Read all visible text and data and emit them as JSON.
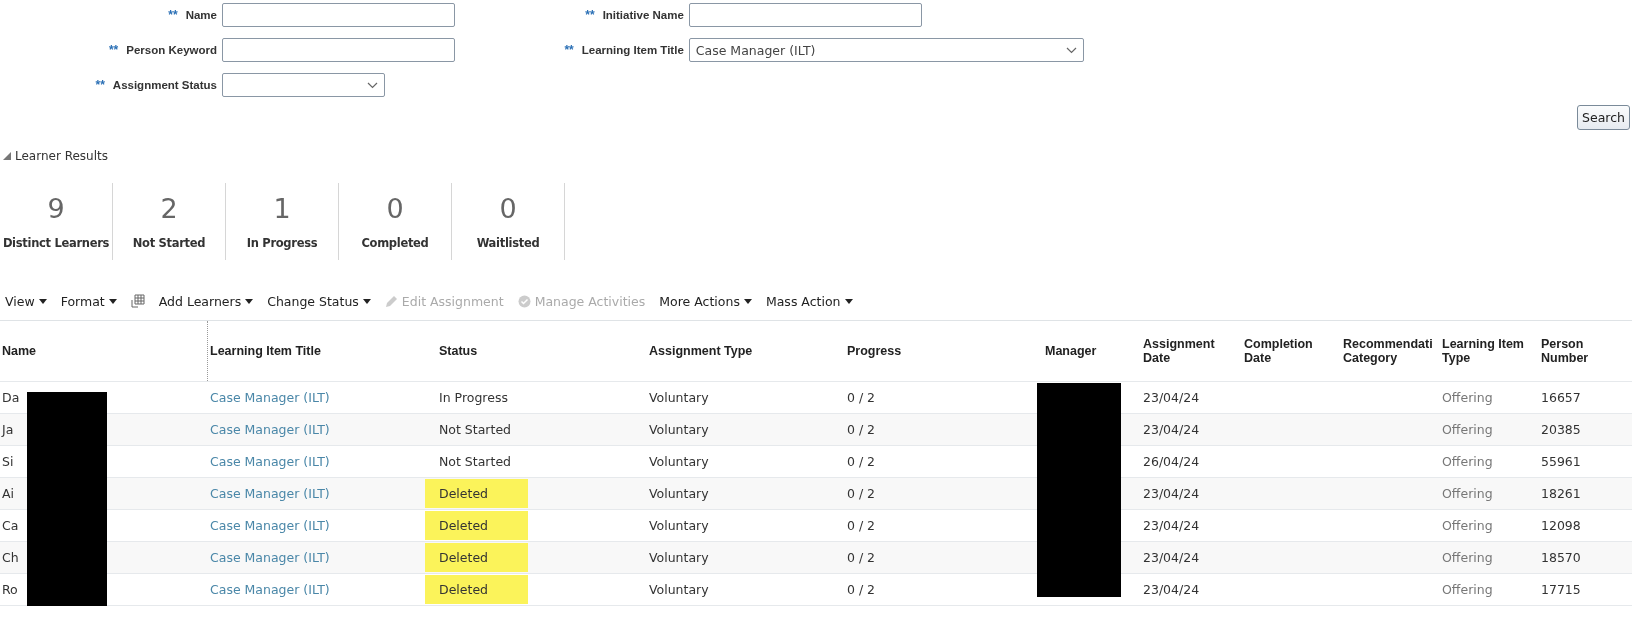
{
  "search_form": {
    "left_fields": [
      {
        "marker": "**",
        "label": "Name",
        "kind": "text"
      },
      {
        "marker": "**",
        "label": "Person Keyword",
        "kind": "text"
      },
      {
        "marker": "**",
        "label": "Assignment Status",
        "kind": "select"
      }
    ],
    "right_fields": [
      {
        "marker": "**",
        "label": "Initiative Name",
        "kind": "text"
      },
      {
        "marker": "**",
        "label": "Learning Item Title",
        "kind": "select",
        "value": "Case Manager (ILT)"
      }
    ],
    "search_button": "Search"
  },
  "section": {
    "title": "Learner Results",
    "expanded": true
  },
  "tiles": [
    {
      "value": "9",
      "label": "Distinct Learners"
    },
    {
      "value": "2",
      "label": "Not Started"
    },
    {
      "value": "1",
      "label": "In Progress"
    },
    {
      "value": "0",
      "label": "Completed"
    },
    {
      "value": "0",
      "label": "Waitlisted"
    }
  ],
  "toolbar": [
    {
      "kind": "menu",
      "label": "View",
      "disabled": false
    },
    {
      "kind": "menu",
      "label": "Format",
      "disabled": false
    },
    {
      "kind": "grid"
    },
    {
      "kind": "menu",
      "label": "Add Learners",
      "disabled": false
    },
    {
      "kind": "menu",
      "label": "Change Status",
      "disabled": false
    },
    {
      "kind": "edit",
      "label": "Edit Assignment",
      "disabled": true
    },
    {
      "kind": "check",
      "label": "Manage Activities",
      "disabled": true
    },
    {
      "kind": "menu",
      "label": "More Actions",
      "disabled": false
    },
    {
      "kind": "menu",
      "label": "Mass Action",
      "disabled": false
    }
  ],
  "table": {
    "columns": [
      "Name",
      "Learning Item Title",
      "Status",
      "Assignment Type",
      "Progress",
      "Manager",
      "Assignment Date",
      "Completion Date",
      "Recommendati Category",
      "Learning Item Type",
      "Person Number"
    ],
    "rows": [
      {
        "name": "Da",
        "title": "Case Manager (ILT)",
        "status": "In Progress",
        "highlighted": false,
        "type": "Voluntary",
        "progress": "0 / 2",
        "date": "23/04/24",
        "item_type": "Offering",
        "number": "16657"
      },
      {
        "name": "Ja",
        "title": "Case Manager (ILT)",
        "status": "Not Started",
        "highlighted": false,
        "type": "Voluntary",
        "progress": "0 / 2",
        "date": "23/04/24",
        "item_type": "Offering",
        "number": "20385"
      },
      {
        "name": "Si",
        "title": "Case Manager (ILT)",
        "status": "Not Started",
        "highlighted": false,
        "type": "Voluntary",
        "progress": "0 / 2",
        "date": "26/04/24",
        "item_type": "Offering",
        "number": "55961"
      },
      {
        "name": "Ai",
        "title": "Case Manager (ILT)",
        "status": "Deleted",
        "highlighted": true,
        "type": "Voluntary",
        "progress": "0 / 2",
        "date": "23/04/24",
        "item_type": "Offering",
        "number": "18261"
      },
      {
        "name": "Ca",
        "title": "Case Manager (ILT)",
        "status": "Deleted",
        "highlighted": true,
        "type": "Voluntary",
        "progress": "0 / 2",
        "date": "23/04/24",
        "item_type": "Offering",
        "number": "12098"
      },
      {
        "name": "Ch",
        "title": "Case Manager (ILT)",
        "status": "Deleted",
        "highlighted": true,
        "type": "Voluntary",
        "progress": "0 / 2",
        "date": "23/04/24",
        "item_type": "Offering",
        "number": "18570"
      },
      {
        "name": "Ro",
        "title": "Case Manager (ILT)",
        "status": "Deleted",
        "highlighted": true,
        "type": "Voluntary",
        "progress": "0 / 2",
        "date": "23/04/24",
        "item_type": "Offering",
        "number": "17715"
      }
    ]
  }
}
